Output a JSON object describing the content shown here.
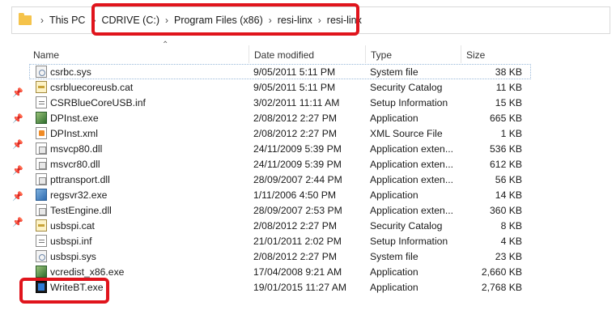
{
  "breadcrumb": {
    "items": [
      "This PC",
      "CDRIVE (C:)",
      "Program Files (x86)",
      "resi-linx",
      "resi-linx"
    ]
  },
  "columns": {
    "name": "Name",
    "date": "Date modified",
    "type": "Type",
    "size": "Size"
  },
  "files": [
    {
      "name": "csrbc.sys",
      "date": "9/05/2011 5:11 PM",
      "type": "System file",
      "size": "38 KB",
      "icon": "sys-file-icon"
    },
    {
      "name": "csrbluecoreusb.cat",
      "date": "9/05/2011 5:11 PM",
      "type": "Security Catalog",
      "size": "11 KB",
      "icon": "catalog-icon"
    },
    {
      "name": "CSRBlueCoreUSB.inf",
      "date": "3/02/2011 11:11 AM",
      "type": "Setup Information",
      "size": "15 KB",
      "icon": "inf-file-icon"
    },
    {
      "name": "DPInst.exe",
      "date": "2/08/2012 2:27 PM",
      "type": "Application",
      "size": "665 KB",
      "icon": "installer-exe-icon"
    },
    {
      "name": "DPInst.xml",
      "date": "2/08/2012 2:27 PM",
      "type": "XML Source File",
      "size": "1 KB",
      "icon": "xml-file-icon"
    },
    {
      "name": "msvcp80.dll",
      "date": "24/11/2009 5:39 PM",
      "type": "Application exten...",
      "size": "536 KB",
      "icon": "dll-file-icon"
    },
    {
      "name": "msvcr80.dll",
      "date": "24/11/2009 5:39 PM",
      "type": "Application exten...",
      "size": "612 KB",
      "icon": "dll-file-icon"
    },
    {
      "name": "pttransport.dll",
      "date": "28/09/2007 2:44 PM",
      "type": "Application exten...",
      "size": "56 KB",
      "icon": "dll-file-icon"
    },
    {
      "name": "regsvr32.exe",
      "date": "1/11/2006 4:50 PM",
      "type": "Application",
      "size": "14 KB",
      "icon": "exe-file-icon"
    },
    {
      "name": "TestEngine.dll",
      "date": "28/09/2007 2:53 PM",
      "type": "Application exten...",
      "size": "360 KB",
      "icon": "dll-file-icon"
    },
    {
      "name": "usbspi.cat",
      "date": "2/08/2012 2:27 PM",
      "type": "Security Catalog",
      "size": "8 KB",
      "icon": "catalog-icon"
    },
    {
      "name": "usbspi.inf",
      "date": "21/01/2011 2:02 PM",
      "type": "Setup Information",
      "size": "4 KB",
      "icon": "inf-file-icon"
    },
    {
      "name": "usbspi.sys",
      "date": "2/08/2012 2:27 PM",
      "type": "System file",
      "size": "23 KB",
      "icon": "sys-file-icon"
    },
    {
      "name": "vcredist_x86.exe",
      "date": "17/04/2008 9:21 AM",
      "type": "Application",
      "size": "2,660 KB",
      "icon": "installer-exe-icon"
    },
    {
      "name": "WriteBT.exe",
      "date": "19/01/2015 11:27 AM",
      "type": "Application",
      "size": "2,768 KB",
      "icon": "app-exe-icon"
    }
  ],
  "colors": {
    "highlight": "#e0141c",
    "folder": "#f5c34b"
  }
}
